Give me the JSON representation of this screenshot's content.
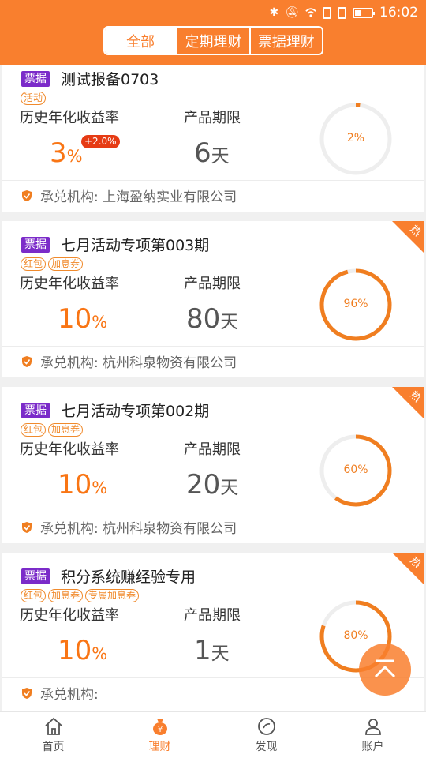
{
  "status_bar": {
    "time": "16:02"
  },
  "tabs": [
    {
      "label": "全部",
      "active": true
    },
    {
      "label": "定期理财",
      "active": false
    },
    {
      "label": "票据理财",
      "active": false
    }
  ],
  "labels": {
    "rate": "历史年化收益率",
    "term": "产品期限",
    "issuer_prefix": "承兑机构:"
  },
  "products": [
    {
      "type": "票据",
      "title": "测试报备0703",
      "tags": [
        "活动"
      ],
      "rate": "3",
      "rate_unit": "%",
      "bonus": "+2.0%",
      "term": "6",
      "term_unit": "天",
      "progress": 0.02,
      "progress_label": "2%",
      "issuer": "承兑机构: 上海盈纳实业有限公司",
      "hot": false
    },
    {
      "type": "票据",
      "title": "七月活动专项第003期",
      "tags": [
        "红包",
        "加息券"
      ],
      "rate": "10",
      "rate_unit": "%",
      "term": "80",
      "term_unit": "天",
      "progress": 0.96,
      "progress_label": "96%",
      "issuer": "承兑机构: 杭州科泉物资有限公司",
      "hot": true,
      "hot_label": "热"
    },
    {
      "type": "票据",
      "title": "七月活动专项第002期",
      "tags": [
        "红包",
        "加息券"
      ],
      "rate": "10",
      "rate_unit": "%",
      "term": "20",
      "term_unit": "天",
      "progress": 0.6,
      "progress_label": "60%",
      "issuer": "承兑机构: 杭州科泉物资有限公司",
      "hot": true,
      "hot_label": "热"
    },
    {
      "type": "票据",
      "title": "积分系统赚经验专用",
      "tags": [
        "红包",
        "加息券",
        "专属加息券"
      ],
      "rate": "10",
      "rate_unit": "%",
      "term": "1",
      "term_unit": "天",
      "progress": 0.8,
      "progress_label": "80%",
      "issuer": "承兑机构:",
      "hot": true,
      "hot_label": "热"
    }
  ],
  "bottom_nav": [
    {
      "label": "首页",
      "icon": "home-icon",
      "active": false
    },
    {
      "label": "理财",
      "icon": "money-bag-icon",
      "active": true
    },
    {
      "label": "发现",
      "icon": "discover-icon",
      "active": false
    },
    {
      "label": "账户",
      "icon": "user-icon",
      "active": false
    }
  ],
  "colors": {
    "brand": "#f97f2e",
    "badge": "#7b2bc9",
    "bonus": "#e63b14"
  }
}
